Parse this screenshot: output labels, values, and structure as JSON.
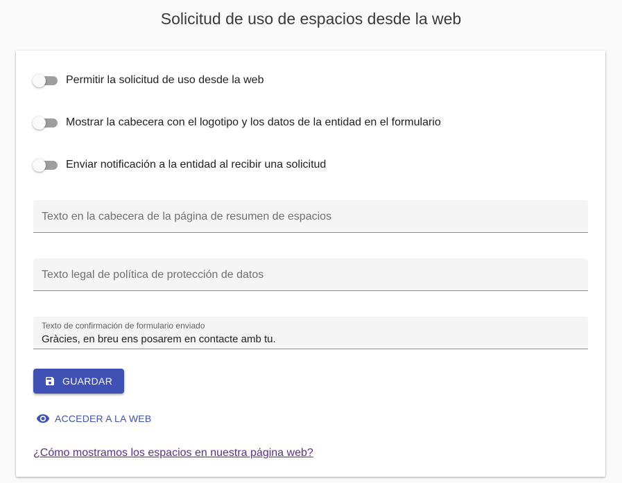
{
  "page": {
    "title": "Solicitud de uso de espacios desde la web"
  },
  "toggles": [
    {
      "label": "Permitir la solicitud de uso desde la web",
      "checked": false
    },
    {
      "label": "Mostrar la cabecera con el logotipo y los datos de la entidad en el formulario",
      "checked": false
    },
    {
      "label": "Enviar notificación a la entidad al recibir una solicitud",
      "checked": false
    }
  ],
  "fields": {
    "header_text": {
      "placeholder": "Texto en la cabecera de la página de resumen de espacios",
      "value": ""
    },
    "legal_text": {
      "placeholder": "Texto legal de política de protección de datos",
      "value": ""
    },
    "confirmation_text": {
      "label": "Texto de confirmación de formulario enviado",
      "value": "Gràcies, en breu ens posarem en contacte amb tu."
    }
  },
  "actions": {
    "save_label": "GUARDAR",
    "save_icon": "floppy-disk-icon",
    "web_label": "ACCEDER A LA WEB",
    "web_icon": "eye-icon",
    "help_link": "¿Cómo mostramos los espacios en nuestra página web?"
  },
  "colors": {
    "primary": "#3f51b5",
    "link_visited": "#5c2d91",
    "toggle_off_track": "#9e9e9e"
  }
}
